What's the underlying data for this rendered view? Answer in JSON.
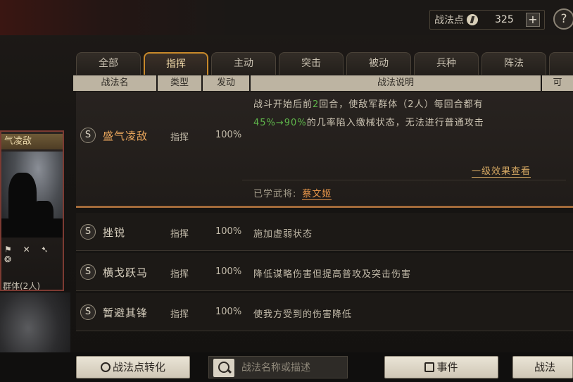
{
  "topbar": {
    "points_label": "战法点",
    "points_value": "325",
    "plus_label": "+",
    "help_label": "?"
  },
  "card": {
    "title": "气凌敌",
    "icons": "⚑ ✕ ➷ ❂",
    "subtitle": "群体(2人)"
  },
  "tabs": [
    "全部",
    "指挥",
    "主动",
    "突击",
    "被动",
    "兵种",
    "阵法"
  ],
  "active_tab": "指挥",
  "headers": {
    "name": "战法名",
    "type": "类型",
    "rate": "发动",
    "desc": "战法说明",
    "extra": "可"
  },
  "expanded": {
    "grade": "S",
    "name": "盛气凌敌",
    "type": "指挥",
    "rate": "100%",
    "desc_1a": "战斗开始后前",
    "desc_1b": "2",
    "desc_1c": "回合，使敌军群体（2人）每回合都有",
    "desc_2a": "45%→90%",
    "desc_2b": "的几率陷入缴械状态，无法进行普通攻击",
    "effect_link": "一级效果查看",
    "learned_label": "已学武将:",
    "learned_name": "蔡文姬"
  },
  "rows": [
    {
      "grade": "S",
      "name": "挫锐",
      "type": "指挥",
      "rate": "100%",
      "desc": "施加虚弱状态"
    },
    {
      "grade": "S",
      "name": "横戈跃马",
      "type": "指挥",
      "rate": "100%",
      "desc": "降低谋略伤害但提高普攻及突击伤害"
    },
    {
      "grade": "S",
      "name": "暂避其锋",
      "type": "指挥",
      "rate": "100%",
      "desc": "使我方受到的伤害降低"
    }
  ],
  "bottom": {
    "convert_label": "战法点转化",
    "search_placeholder": "战法名称或描述",
    "event_label": "事件",
    "right_label": "战法"
  },
  "colors": {
    "accent": "#c8892a",
    "highlight": "#e6954a",
    "green": "#5fb64b"
  }
}
